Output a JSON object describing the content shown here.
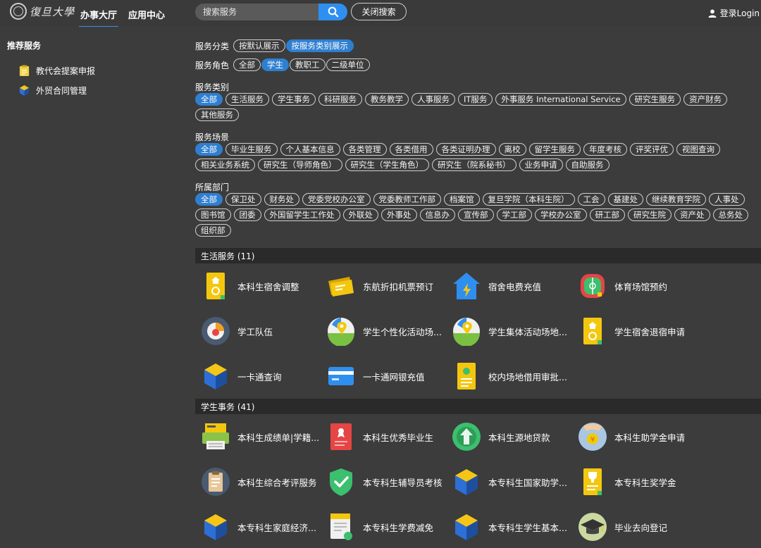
{
  "header": {
    "logo_text": "復旦大學",
    "tabs": [
      "办事大厅",
      "应用中心"
    ],
    "search_placeholder": "搜索服务",
    "close_search": "关闭搜索",
    "login": "登录Login"
  },
  "sidebar": {
    "title": "推荐服务",
    "items": [
      {
        "label": "教代会提案申报",
        "icon": "notepad-icon"
      },
      {
        "label": "外贸合同管理",
        "icon": "cube-icon"
      }
    ]
  },
  "filters": {
    "category_label": "服务分类",
    "category_options": [
      "按默认展示",
      "按服务类别展示"
    ],
    "category_active": 1,
    "role_label": "服务角色",
    "role_options": [
      "全部",
      "学生",
      "教职工",
      "二级单位"
    ],
    "role_active": 1,
    "type_label": "服务类别",
    "type_options": [
      "全部",
      "生活服务",
      "学生事务",
      "科研服务",
      "教务教学",
      "人事服务",
      "IT服务",
      "外事服务 International Service",
      "研究生服务",
      "资产财务",
      "其他服务"
    ],
    "scene_label": "服务场景",
    "scene_options": [
      "全部",
      "毕业生服务",
      "个人基本信息",
      "各类管理",
      "各类借用",
      "各类证明办理",
      "离校",
      "留学生服务",
      "年度考核",
      "评奖评优",
      "视图查询",
      "相关业务系统",
      "研究生（导师角色）",
      "研究生（学生角色）",
      "研究生（院系秘书）",
      "业务申请",
      "自助服务"
    ],
    "dept_label": "所属部门",
    "dept_options": [
      "全部",
      "保卫处",
      "财务处",
      "党委党校办公室",
      "党委教师工作部",
      "档案馆",
      "复旦学院（本科生院）",
      "工会",
      "基建处",
      "继续教育学院",
      "人事处",
      "图书馆",
      "团委",
      "外国留学生工作处",
      "外联处",
      "外事处",
      "信息办",
      "宣传部",
      "学工部",
      "学校办公室",
      "研工部",
      "研究生院",
      "资产处",
      "总务处",
      "组织部"
    ]
  },
  "sections": [
    {
      "title": "生活服务 (11)",
      "services": [
        {
          "label": "本科生宿舍调整",
          "icon": "dorm-doc-icon"
        },
        {
          "label": "东航折扣机票预订",
          "icon": "ticket-icon"
        },
        {
          "label": "宿舍电费充值",
          "icon": "house-power-icon"
        },
        {
          "label": "体育场馆预约",
          "icon": "stadium-icon"
        },
        {
          "label": "学工队伍",
          "icon": "team-icon"
        },
        {
          "label": "学生个性化活动场...",
          "icon": "map-pin-icon"
        },
        {
          "label": "学生集体活动场地...",
          "icon": "map-pin-icon"
        },
        {
          "label": "学生宿舍退宿申请",
          "icon": "dorm-doc-icon"
        },
        {
          "label": "一卡通查询",
          "icon": "cube-icon"
        },
        {
          "label": "一卡通网银充值",
          "icon": "card-icon"
        },
        {
          "label": "校内场地借用审批...",
          "icon": "badge-doc-icon"
        }
      ]
    },
    {
      "title": "学生事务 (41)",
      "services": [
        {
          "label": "本科生成绩单|学籍...",
          "icon": "printer-icon"
        },
        {
          "label": "本科生优秀毕业生",
          "icon": "red-doc-icon"
        },
        {
          "label": "本科生源地贷款",
          "icon": "upload-arrow-icon"
        },
        {
          "label": "本科生助学金申请",
          "icon": "hand-coin-icon"
        },
        {
          "label": "本科生综合考评服务",
          "icon": "clipboard-icon"
        },
        {
          "label": "本专科生辅导员考核",
          "icon": "shield-check-icon"
        },
        {
          "label": "本专科生国家助学...",
          "icon": "cube-icon"
        },
        {
          "label": "本专科生奖学金",
          "icon": "trophy-doc-icon"
        },
        {
          "label": "本专科生家庭经济...",
          "icon": "cube-icon"
        },
        {
          "label": "本专科生学费减免",
          "icon": "fee-doc-icon"
        },
        {
          "label": "本专科生学生基本...",
          "icon": "cube-icon"
        },
        {
          "label": "毕业去向登记",
          "icon": "graduation-cap-icon"
        }
      ]
    }
  ],
  "colors": {
    "accent": "#2f7fd1",
    "background": "#3c3c3c",
    "section_bar": "#2a2a2a"
  }
}
